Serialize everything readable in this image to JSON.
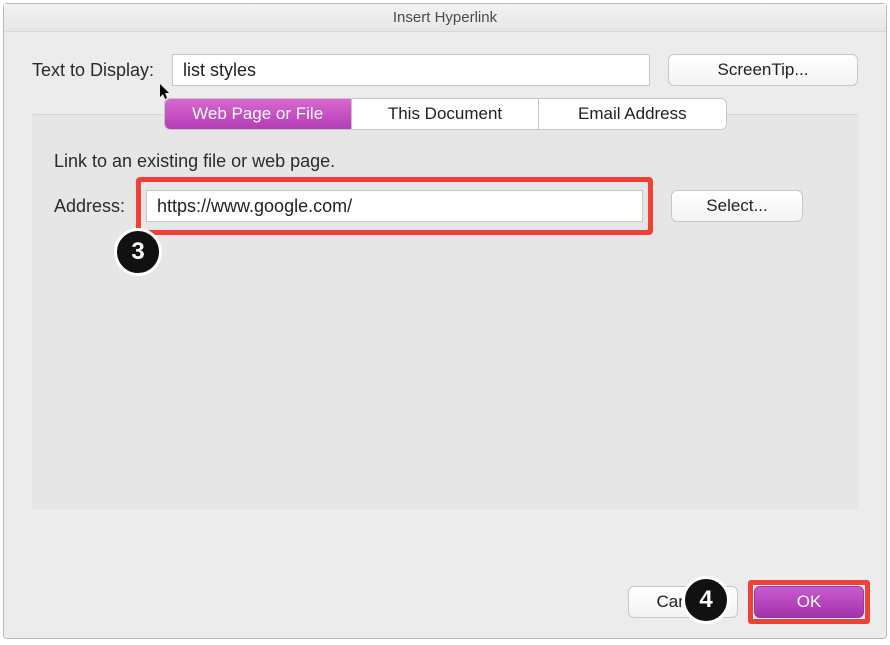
{
  "dialog": {
    "title": "Insert Hyperlink"
  },
  "textDisplay": {
    "label": "Text to Display:",
    "value": "list styles"
  },
  "screentip": {
    "label": "ScreenTip..."
  },
  "tabs": {
    "webPage": "Web Page or File",
    "thisDocument": "This Document",
    "emailAddress": "Email Address"
  },
  "panel": {
    "instruction": "Link to an existing file or web page.",
    "addressLabel": "Address:",
    "addressValue": "https://www.google.com/",
    "selectLabel": "Select..."
  },
  "footer": {
    "cancel": "Cancel",
    "ok": "OK"
  },
  "callouts": {
    "step3": "3",
    "step4": "4"
  }
}
